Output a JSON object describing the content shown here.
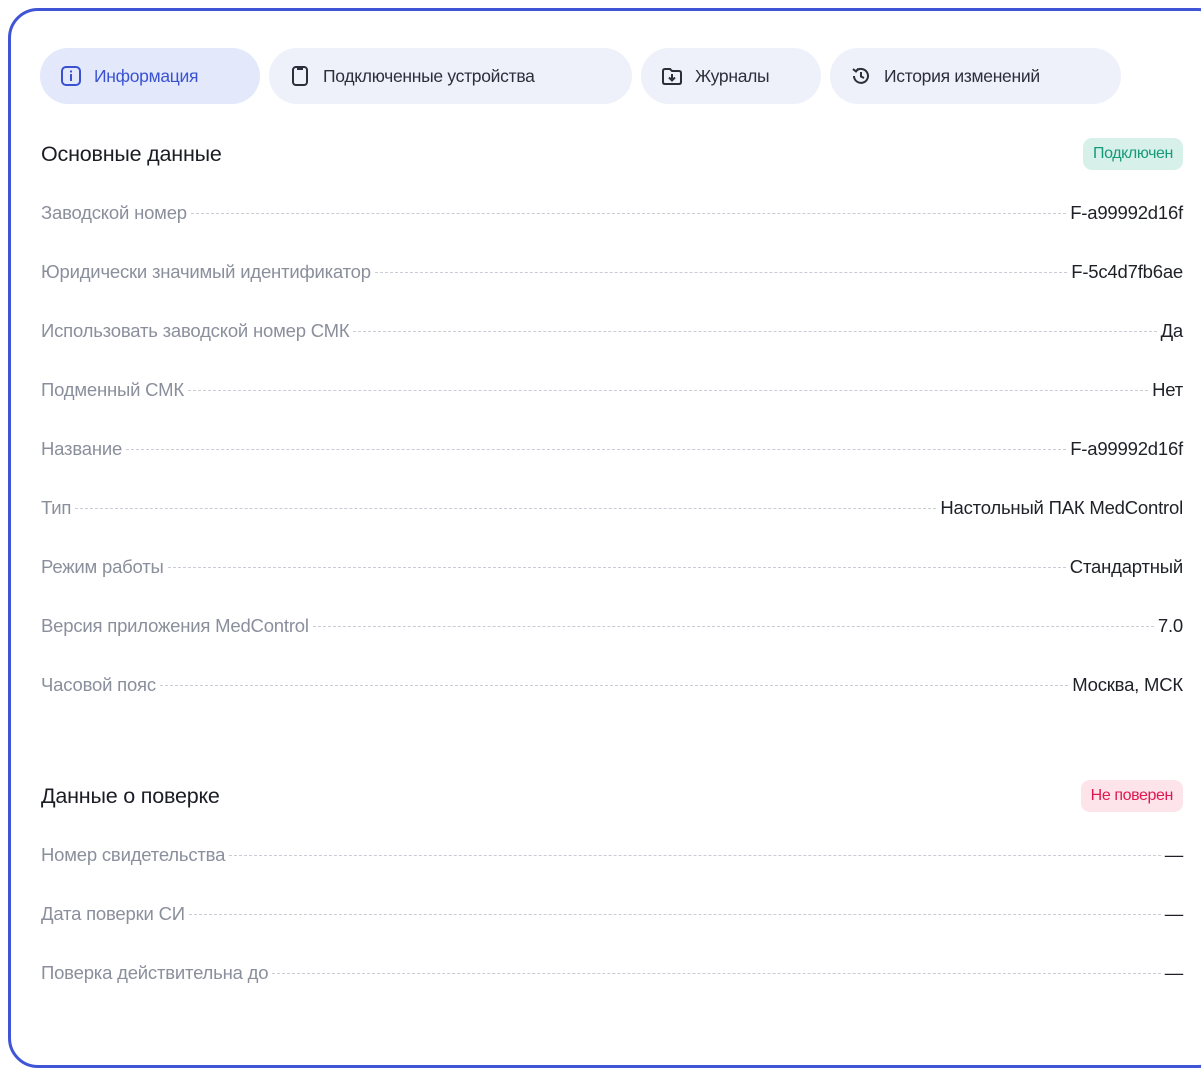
{
  "tabs": [
    {
      "label": "Информация",
      "icon": "info-icon",
      "active": true
    },
    {
      "label": "Подключенные устройства",
      "icon": "device-icon",
      "active": false
    },
    {
      "label": "Журналы",
      "icon": "folder-download-icon",
      "active": false
    },
    {
      "label": "История изменений",
      "icon": "history-icon",
      "active": false
    }
  ],
  "basic": {
    "title": "Основные данные",
    "status": "Подключен",
    "rows": [
      {
        "label": "Заводской номер",
        "value": "F-a99992d16f"
      },
      {
        "label": "Юридически значимый идентификатор",
        "value": "F-5c4d7fb6ae"
      },
      {
        "label": "Использовать заводской номер СМК",
        "value": "Да"
      },
      {
        "label": "Подменный СМК",
        "value": "Нет"
      },
      {
        "label": "Название",
        "value": "F-a99992d16f"
      },
      {
        "label": "Тип",
        "value": "Настольный ПАК MedControl"
      },
      {
        "label": "Режим работы",
        "value": "Стандартный"
      },
      {
        "label": "Версия приложения MedControl",
        "value": "7.0"
      },
      {
        "label": "Часовой пояс",
        "value": "Москва, МСК"
      }
    ]
  },
  "verification": {
    "title": "Данные о поверке",
    "status": "Не поверен",
    "rows": [
      {
        "label": "Номер свидетельства",
        "value": "—"
      },
      {
        "label": "Дата поверки СИ",
        "value": "—"
      },
      {
        "label": "Поверка действительна до",
        "value": "—"
      }
    ]
  },
  "colors": {
    "accent": "#3f55d6",
    "status_ok": "#159a7a",
    "status_bad": "#e0184f"
  }
}
